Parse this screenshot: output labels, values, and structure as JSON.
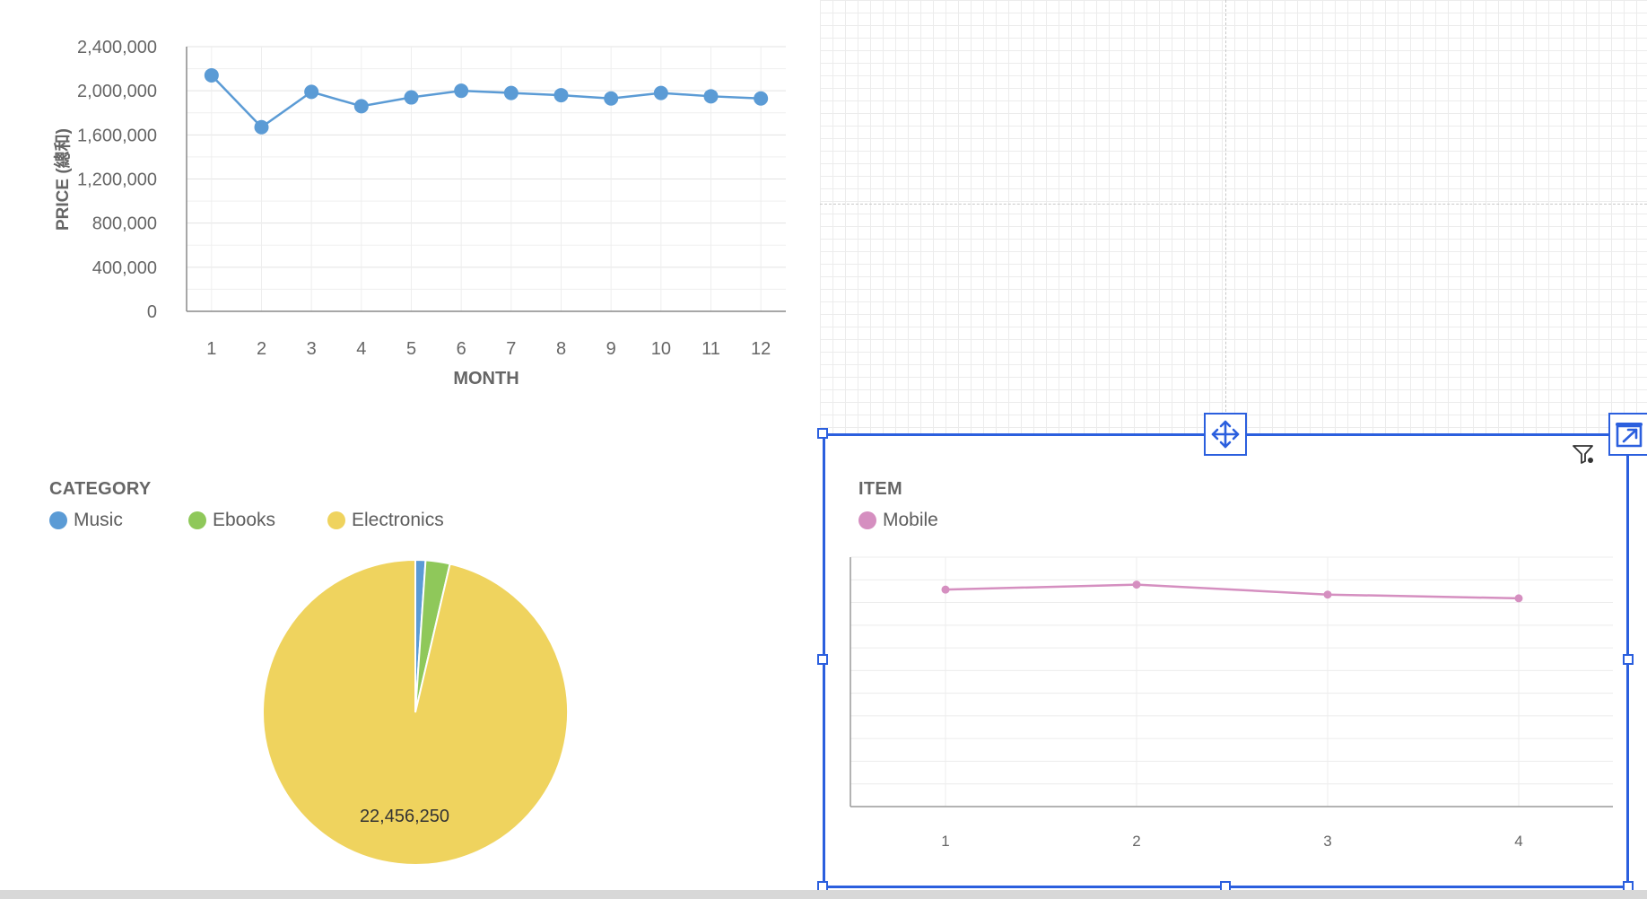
{
  "colors": {
    "accent": "#2b5fde",
    "line_series": "#5b9bd5",
    "mobile_series": "#d58fc0",
    "music": "#5b9bd5",
    "ebooks": "#8fc85a",
    "electronics": "#efd35e",
    "axis_text": "#666666"
  },
  "icons": {
    "move": "move-arrows-icon",
    "expand": "expand-arrow-icon",
    "filter": "filter-icon"
  },
  "chart_data": [
    {
      "type": "line",
      "title": "",
      "xlabel": "MONTH",
      "ylabel": "PRICE (總和)",
      "categories": [
        "1",
        "2",
        "3",
        "4",
        "5",
        "6",
        "7",
        "8",
        "9",
        "10",
        "11",
        "12"
      ],
      "series": [
        {
          "values": [
            2140000,
            1670000,
            1990000,
            1860000,
            1940000,
            2000000,
            1980000,
            1960000,
            1930000,
            1980000,
            1950000,
            1930000
          ]
        }
      ],
      "yticks": [
        "0",
        "400,000",
        "800,000",
        "1,200,000",
        "1,600,000",
        "2,000,000",
        "2,400,000"
      ],
      "ylim": [
        0,
        2400000
      ],
      "grid": true
    },
    {
      "type": "pie",
      "legend_title": "CATEGORY",
      "legend_position": "top-left",
      "series": [
        {
          "name": "Music",
          "value": 250000
        },
        {
          "name": "Ebooks",
          "value": 600000
        },
        {
          "name": "Electronics",
          "value": 22456250
        }
      ],
      "data_labels": [
        "22,456,250"
      ]
    },
    {
      "type": "line",
      "legend_title": "ITEM",
      "legend_position": "top-left",
      "categories": [
        "1",
        "2",
        "3",
        "4"
      ],
      "series": [
        {
          "name": "Mobile",
          "values": [
            0.87,
            0.89,
            0.85,
            0.835
          ]
        }
      ],
      "ylim": [
        0,
        1
      ],
      "grid": true
    }
  ]
}
